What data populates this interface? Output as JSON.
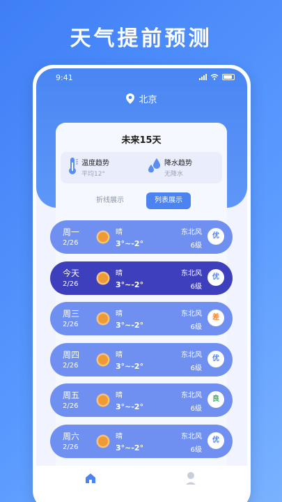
{
  "promo": {
    "title": "天气提前预测"
  },
  "status": {
    "time": "9:41"
  },
  "location": {
    "city": "北京",
    "icon": "location-pin-icon"
  },
  "forecast": {
    "title": "未来15天",
    "trends": [
      {
        "label": "温度趋势",
        "sub": "平均12°",
        "icon": "thermometer-icon"
      },
      {
        "label": "降水趋势",
        "sub": "无降水",
        "icon": "raindrops-icon"
      }
    ],
    "tabs": [
      {
        "label": "折线展示",
        "active": false
      },
      {
        "label": "列表展示",
        "active": true
      }
    ],
    "days": [
      {
        "name": "周一",
        "date": "2/26",
        "cond": "晴",
        "temp": "3°~-2°",
        "wind": "东北风",
        "level": "6级",
        "aqi": "优",
        "aqi_color": "#4b84f0",
        "today": false
      },
      {
        "name": "今天",
        "date": "2/26",
        "cond": "晴",
        "temp": "3°~-2°",
        "wind": "东北风",
        "level": "6级",
        "aqi": "优",
        "aqi_color": "#4b84f0",
        "today": true
      },
      {
        "name": "周三",
        "date": "2/26",
        "cond": "晴",
        "temp": "3°~-2°",
        "wind": "东北风",
        "level": "6级",
        "aqi": "差",
        "aqi_color": "#f08a2e",
        "today": false
      },
      {
        "name": "周四",
        "date": "2/26",
        "cond": "晴",
        "temp": "3°~-2°",
        "wind": "东北风",
        "level": "6级",
        "aqi": "优",
        "aqi_color": "#4b84f0",
        "today": false
      },
      {
        "name": "周五",
        "date": "2/26",
        "cond": "晴",
        "temp": "3°~-2°",
        "wind": "东北风",
        "level": "6级",
        "aqi": "良",
        "aqi_color": "#32b05a",
        "today": false
      },
      {
        "name": "周六",
        "date": "2/26",
        "cond": "晴",
        "temp": "3°~-2°",
        "wind": "东北风",
        "level": "6级",
        "aqi": "优",
        "aqi_color": "#4b84f0",
        "today": false
      }
    ]
  },
  "nav": {
    "home_icon": "home-icon",
    "profile_icon": "profile-icon"
  },
  "colors": {
    "accent": "#4b84f0",
    "today_row": "#3e3fbd",
    "row": "#6f90f0"
  }
}
